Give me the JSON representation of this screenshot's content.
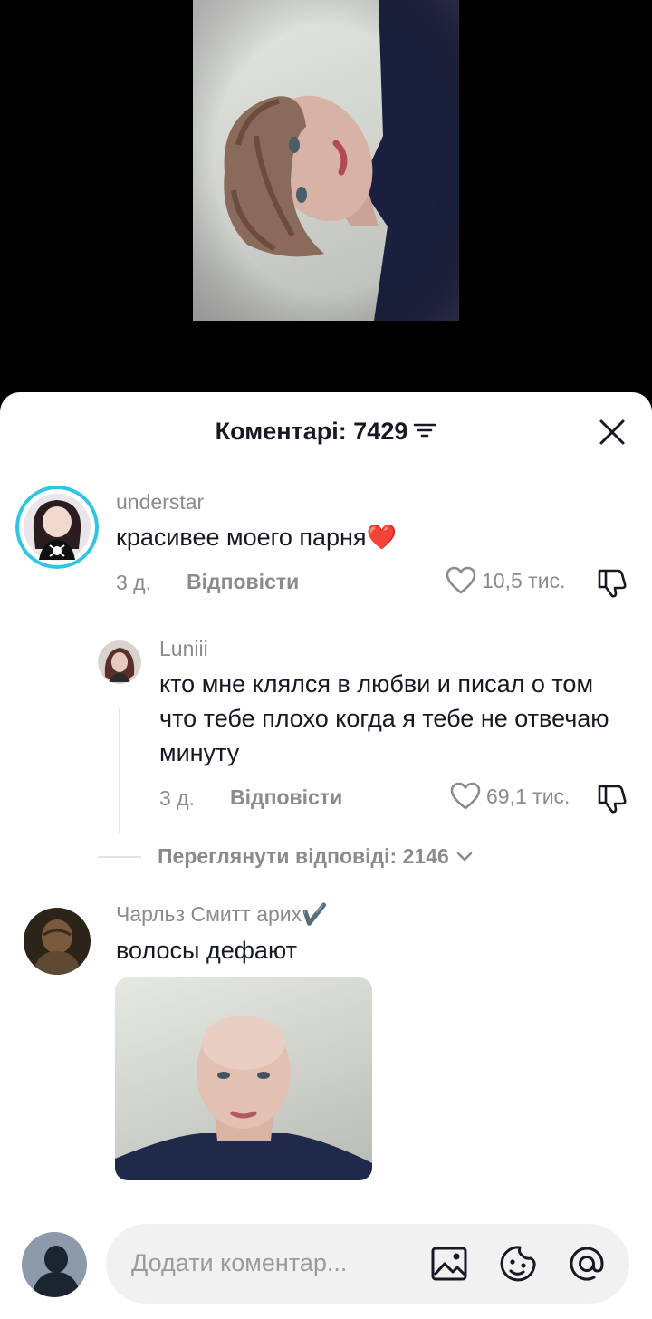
{
  "sheet": {
    "title": "Коментарі: 7429"
  },
  "comments": [
    {
      "username": "understar",
      "text": "красивее моего парня❤️",
      "time": "3 д.",
      "reply_label": "Відповісти",
      "likes": "10,5 тис."
    },
    {
      "username": "Luniii",
      "text": "кто мне клялся в любви и писал о том что тебе плохо когда я тебе не отвечаю минуту",
      "time": "3 д.",
      "reply_label": "Відповісти",
      "likes": "69,1 тис."
    },
    {
      "username": "Чарльз Смитт арих✔️",
      "text": "волосы дефают"
    }
  ],
  "view_replies": "Переглянути відповіді: 2146",
  "input": {
    "placeholder": "Додати коментар..."
  },
  "icons": [
    "filter-icon",
    "close-icon",
    "heart-icon",
    "dislike-icon",
    "chevron-down-icon",
    "image-icon",
    "emoji-icon",
    "at-icon"
  ],
  "colors": {
    "accent_ring": "#2ec5e6",
    "text": "#161823",
    "muted": "#8a8b91"
  }
}
